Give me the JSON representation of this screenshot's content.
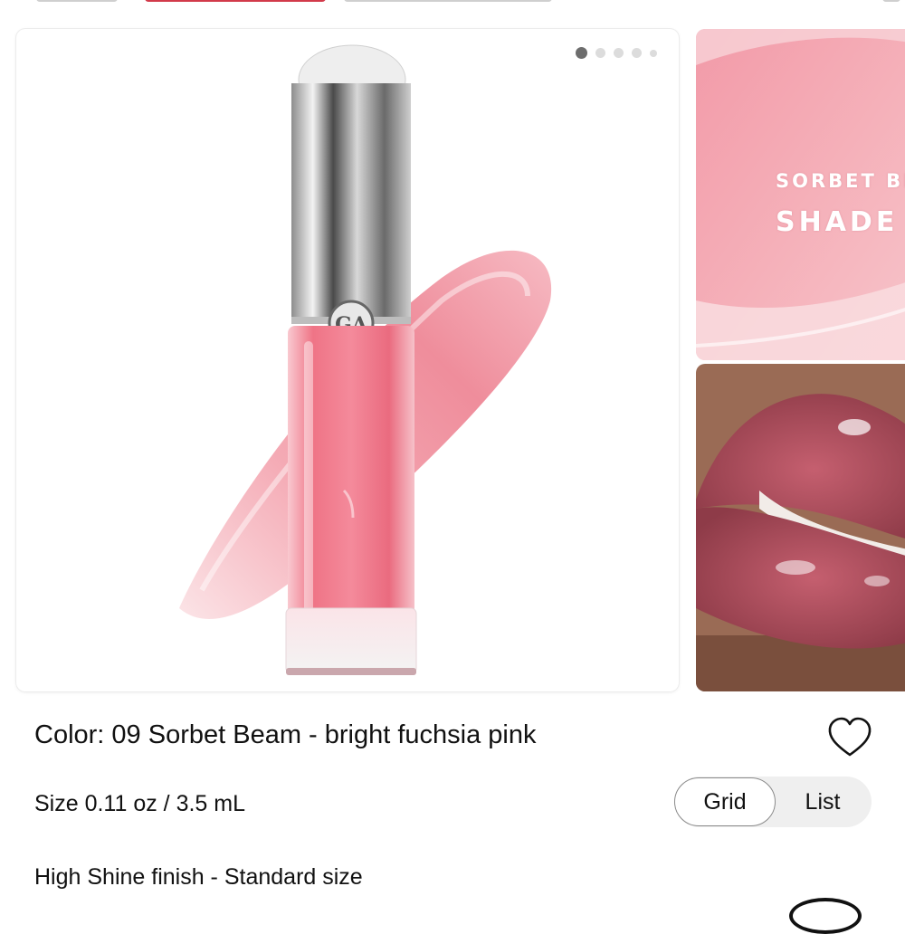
{
  "gallery": {
    "dots_total": 5,
    "active_index": 0,
    "swatch_label_line1": "SORBET BE",
    "swatch_label_line2": "SHADE"
  },
  "product": {
    "color_text": "Color: 09 Sorbet Beam - bright fuchsia pink",
    "size_text": "Size 0.11 oz / 3.5 mL",
    "finish_text": "High Shine finish - Standard size"
  },
  "view_toggle": {
    "options": [
      "Grid",
      "List"
    ],
    "selected": "Grid"
  },
  "icons": {
    "favorite": "heart-outline-icon"
  },
  "colors": {
    "swatch_pink": "#ef9aa8",
    "lipgloss_pink": "#f07d8f",
    "active_dot": "#6d6d6d",
    "inactive_dot": "#dcdcdc",
    "toggle_bg": "#efefef"
  }
}
